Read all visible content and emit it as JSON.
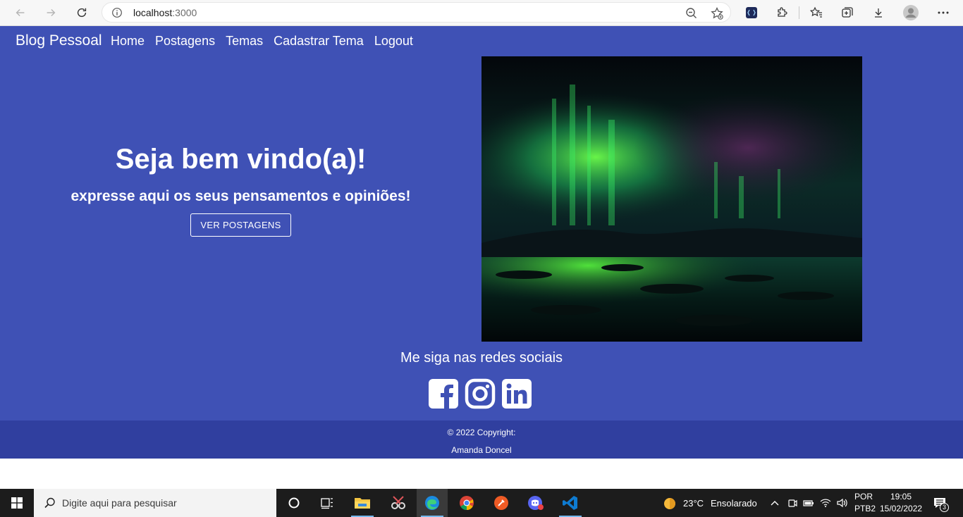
{
  "browser": {
    "url_host": "localhost",
    "url_port": ":3000"
  },
  "navbar": {
    "brand": "Blog Pessoal",
    "items": [
      "Home",
      "Postagens",
      "Temas",
      "Cadastrar Tema",
      "Logout"
    ]
  },
  "hero": {
    "title": "Seja bem vindo(a)!",
    "subtitle": "expresse aqui os seus pensamentos e opiniões!",
    "button": "VER POSTAGENS"
  },
  "social": {
    "title": "Me siga nas redes sociais",
    "icons": [
      "facebook-icon",
      "instagram-icon",
      "linkedin-icon"
    ]
  },
  "footer": {
    "copyright": "© 2022 Copyright:",
    "author": "Amanda Doncel"
  },
  "taskbar": {
    "search_placeholder": "Digite aqui para pesquisar",
    "weather_temp": "23°C",
    "weather_text": "Ensolarado",
    "lang_top": "POR",
    "lang_bottom": "PTB2",
    "time": "19:05",
    "date": "15/02/2022",
    "notification_count": "3"
  },
  "colors": {
    "page_bg": "#3f51b5",
    "footer_bg": "#303f9f",
    "text": "#ffffff"
  }
}
